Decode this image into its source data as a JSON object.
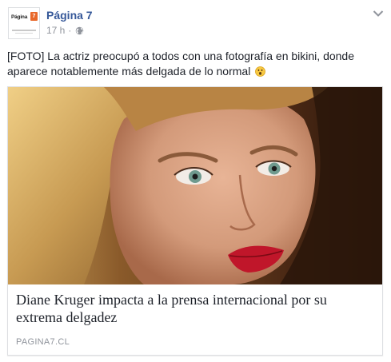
{
  "post": {
    "page_name": "Página 7",
    "timestamp": "17 h",
    "separator": "·",
    "avatar": {
      "logo_text": "Página",
      "logo_badge": "7"
    },
    "text": "[FOTO] La actriz preocupó a todos con una fotografía en bikini, donde aparece notablemente más delgada de lo normal",
    "emoji_icon": "astonished-face-icon",
    "privacy_icon": "globe-icon",
    "menu_icon": "chevron-down-icon"
  },
  "link": {
    "title": "Diane Kruger impacta a la prensa internacional por su extrema delgadez",
    "domain": "PAGINA7.CL"
  },
  "colors": {
    "page_name": "#365899",
    "meta": "#90949c",
    "text": "#1d2129",
    "border": "#dddfe2",
    "logo_badge": "#e8682a"
  }
}
